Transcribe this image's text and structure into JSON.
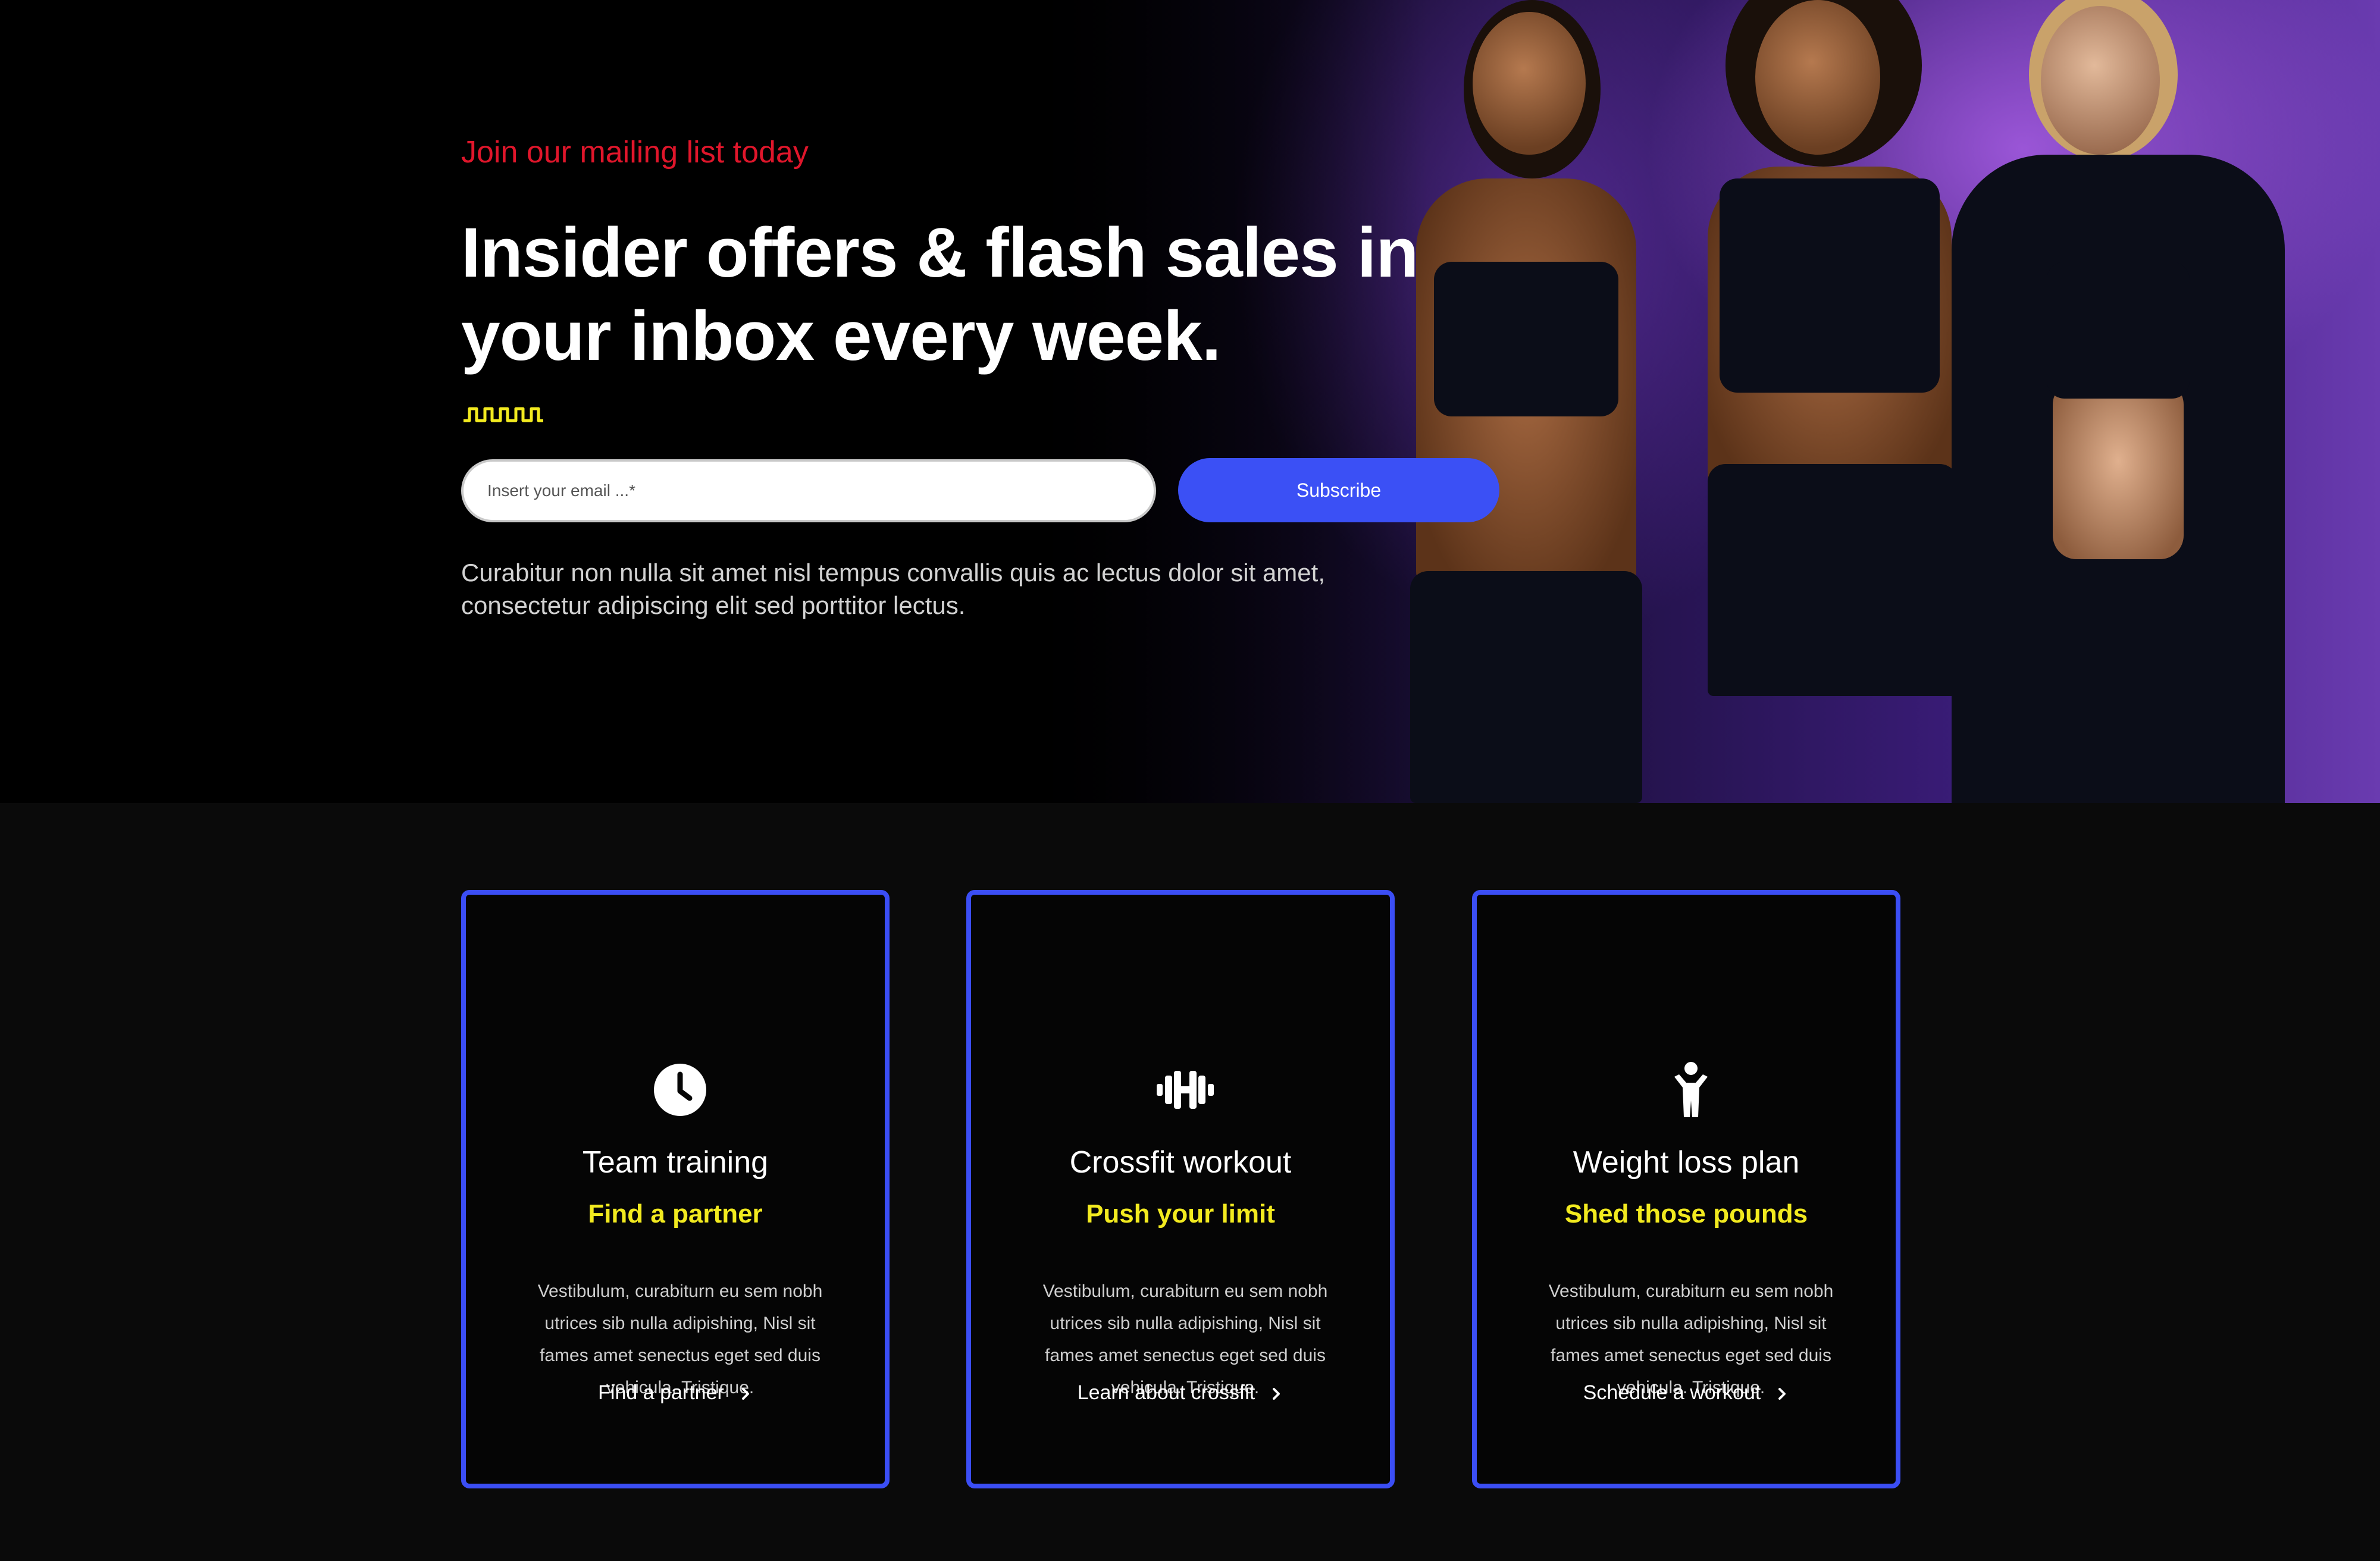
{
  "hero": {
    "eyebrow": "Join our mailing list today",
    "headline": "Insider offers & flash sales in your inbox every week.",
    "email_placeholder": "Insert your email ...*",
    "subscribe_label": "Subscribe",
    "description": "Curabitur non nulla sit amet nisl tempus convallis quis ac lectus dolor sit amet, consectetur adipiscing elit sed porttitor lectus."
  },
  "cards": [
    {
      "icon": "clock-icon",
      "title": "Team training",
      "subtitle": "Find a partner",
      "text": "Vestibulum, curabiturn eu sem nobh utrices sib nulla adipishing, Nisl sit fames amet senectus eget sed duis vehicula. Tristique.",
      "link": "Find a partner"
    },
    {
      "icon": "dumbbell-icon",
      "title": "Crossfit workout",
      "subtitle": "Push your limit",
      "text": "Vestibulum, curabiturn eu sem nobh utrices sib nulla adipishing, Nisl sit fames amet senectus eget sed duis vehicula. Tristique.",
      "link": "Learn about crossfit"
    },
    {
      "icon": "person-icon",
      "title": "Weight loss plan",
      "subtitle": "Shed those pounds",
      "text": "Vestibulum, curabiturn eu sem nobh utrices sib nulla adipishing, Nisl sit fames amet senectus eget sed duis vehicula. Tristique.",
      "link": "Schedule a workout"
    }
  ],
  "colors": {
    "accent_blue": "#3b50f5",
    "eyebrow_red": "#e0162b",
    "subtitle_yellow": "#f2ea1f",
    "hero_purple": "#6a3bb0"
  }
}
